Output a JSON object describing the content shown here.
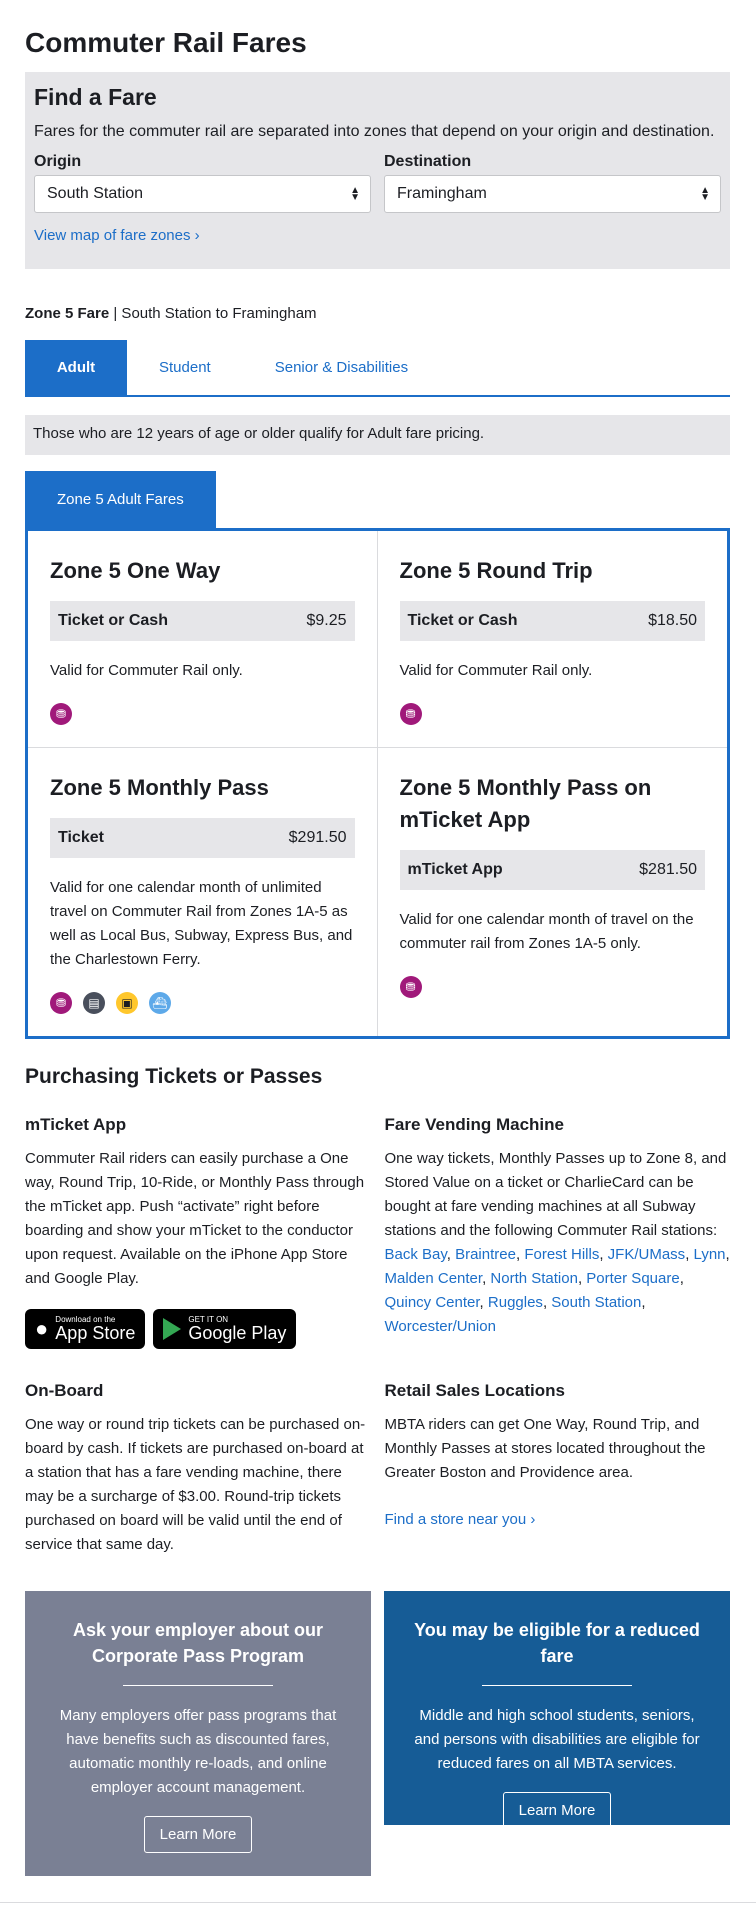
{
  "page": {
    "title": "Commuter Rail Fares"
  },
  "finder": {
    "title": "Find a Fare",
    "description": "Fares for the commuter rail are separated into zones that depend on your origin and destination.",
    "origin_label": "Origin",
    "origin_value": "South Station",
    "destination_label": "Destination",
    "destination_value": "Framingham",
    "map_link": "View map of fare zones ›"
  },
  "zone_summary": {
    "zone": "Zone 5 Fare",
    "route": " | South Station to Framingham"
  },
  "tabs": [
    {
      "label": "Adult",
      "active": true
    },
    {
      "label": "Student",
      "active": false
    },
    {
      "label": "Senior & Disabilities",
      "active": false
    }
  ],
  "tab_note": "Those who are 12 years of age or older qualify for Adult fare pricing.",
  "fare_tab_header": "Zone 5 Adult Fares",
  "fares": [
    {
      "title": "Zone 5 One Way",
      "price_label": "Ticket or Cash",
      "price": "$9.25",
      "description": "Valid for Commuter Rail only.",
      "modes": [
        "commuter-rail"
      ]
    },
    {
      "title": "Zone 5 Round Trip",
      "price_label": "Ticket or Cash",
      "price": "$18.50",
      "description": "Valid for Commuter Rail only.",
      "modes": [
        "commuter-rail"
      ]
    },
    {
      "title": "Zone 5 Monthly Pass",
      "price_label": "Ticket",
      "price": "$291.50",
      "description": "Valid for one calendar month of unlimited travel on Commuter Rail from Zones 1A-5 as well as Local Bus, Subway, Express Bus, and the Charlestown Ferry.",
      "modes": [
        "commuter-rail",
        "bus",
        "subway",
        "ferry"
      ]
    },
    {
      "title": "Zone 5 Monthly Pass on mTicket App",
      "price_label": "mTicket App",
      "price": "$281.50",
      "description": "Valid for one calendar month of travel on the commuter rail from Zones 1A-5 only.",
      "modes": [
        "commuter-rail"
      ]
    }
  ],
  "purchasing": {
    "title": "Purchasing Tickets or Passes",
    "mticket": {
      "title": "mTicket App",
      "text": "Commuter Rail riders can easily purchase a One way, Round Trip, 10-Ride, or Monthly Pass through the mTicket app. Push “activate” right before boarding and show your mTicket to the conductor upon request. Available on the iPhone App Store and Google Play.",
      "appstore_small": "Download on the",
      "appstore_big": "App Store",
      "play_small": "GET IT ON",
      "play_big": "Google Play"
    },
    "vending": {
      "title": "Fare Vending Machine",
      "text": "One way tickets, Monthly Passes up to Zone 8, and Stored Value on a ticket or CharlieCard can be bought at fare vending machines at all Subway stations and the following Commuter Rail stations: ",
      "stations": [
        "Back Bay",
        "Braintree",
        "Forest Hills",
        "JFK/UMass",
        "Lynn",
        "Malden Center",
        "North Station",
        "Porter Square",
        "Quincy Center",
        "Ruggles",
        "South Station",
        "Worcester/Union"
      ]
    },
    "onboard": {
      "title": "On-Board",
      "text": "One way or round trip tickets can be purchased on-board by cash. If tickets are purchased on-board at a station that has a fare vending machine, there may be a surcharge of $3.00. Round-trip tickets purchased on board will be valid until the end of service that same day."
    },
    "retail": {
      "title": "Retail Sales Locations",
      "text": "MBTA riders can get One Way, Round Trip, and Monthly Passes at stores located throughout the Greater Boston and Providence area.",
      "link": "Find a store near you ›"
    }
  },
  "promos": {
    "corporate": {
      "title": "Ask your employer about our Corporate Pass Program",
      "text": "Many employers offer pass programs that have benefits such as discounted fares, automatic monthly re-loads, and online employer account management.",
      "button": "Learn More"
    },
    "reduced": {
      "title": "You may be eligible for a reduced fare",
      "text": "Middle and high school students, seniors, and persons with disabilities are eligible for reduced fares on all MBTA services.",
      "button": "Learn More"
    }
  },
  "colors": {
    "accent": "#1c6ec8",
    "commuter_rail": "#a0197a",
    "bus": "#494f5c",
    "subway": "#ffc72c",
    "ferry": "#5da9e9",
    "promo_gray": "#7a8094",
    "promo_blue": "#165c96"
  }
}
